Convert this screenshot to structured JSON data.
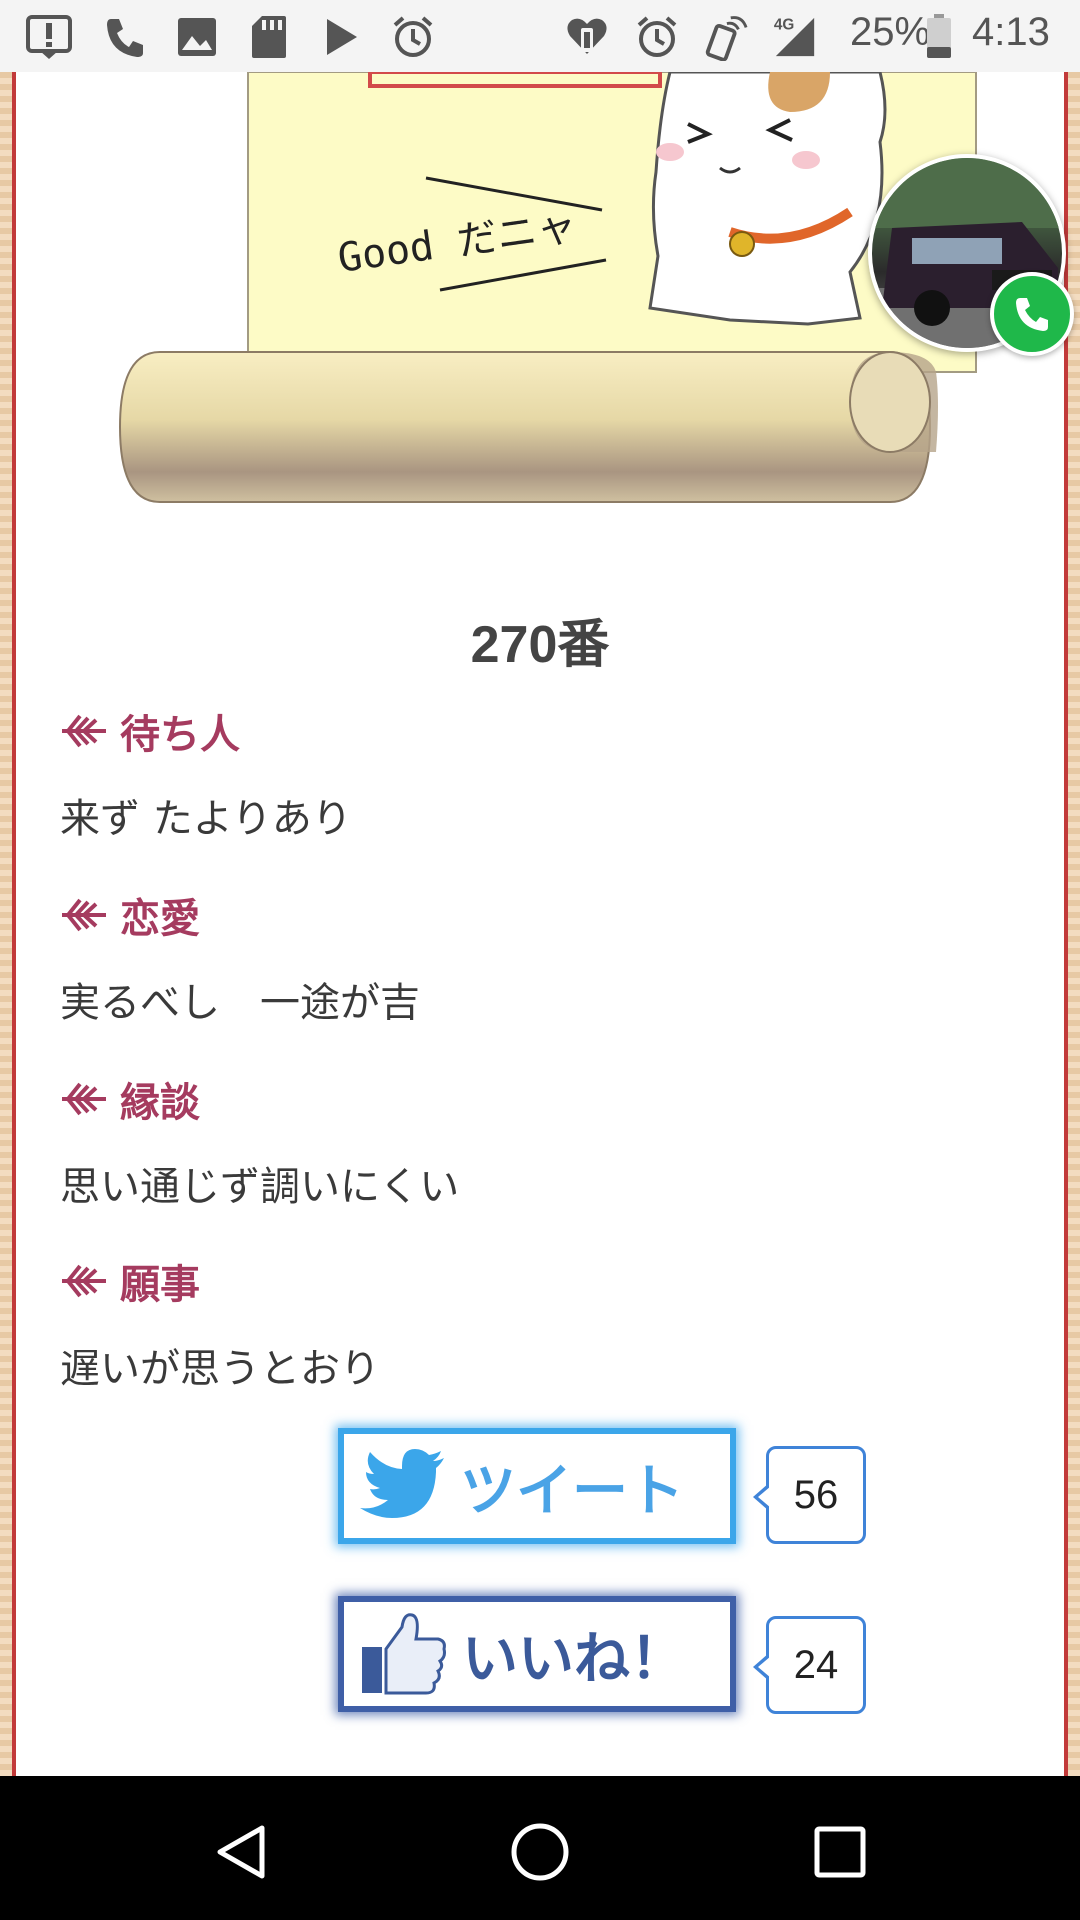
{
  "status_bar": {
    "battery_percent": "25%",
    "time": "4:13",
    "network": "4G",
    "icons": [
      "alert-icon",
      "wifi-calling-icon",
      "image-icon",
      "sd-card-icon",
      "play-icon",
      "alarm-icon",
      "health-icon",
      "alarm-icon",
      "nfc-icon",
      "signal-icon",
      "battery-icon"
    ]
  },
  "scroll": {
    "caption": "Good だニャ"
  },
  "fortune": {
    "number": "270番",
    "items": [
      {
        "label": "待ち人",
        "text": "来ず たよりあり"
      },
      {
        "label": "恋愛",
        "text": "実るべし　一途が吉"
      },
      {
        "label": "縁談",
        "text": "思い通じず調いにくい"
      },
      {
        "label": "願事",
        "text": "遅いが思うとおり"
      }
    ]
  },
  "share": {
    "tweet_label": "ツイート",
    "tweet_count": "56",
    "like_label": "いいね！",
    "like_count": "24"
  },
  "colors": {
    "heading": "#a53b5f",
    "twitter": "#3ba6ea",
    "facebook": "#3f5fa7",
    "call": "#1fb84a"
  }
}
